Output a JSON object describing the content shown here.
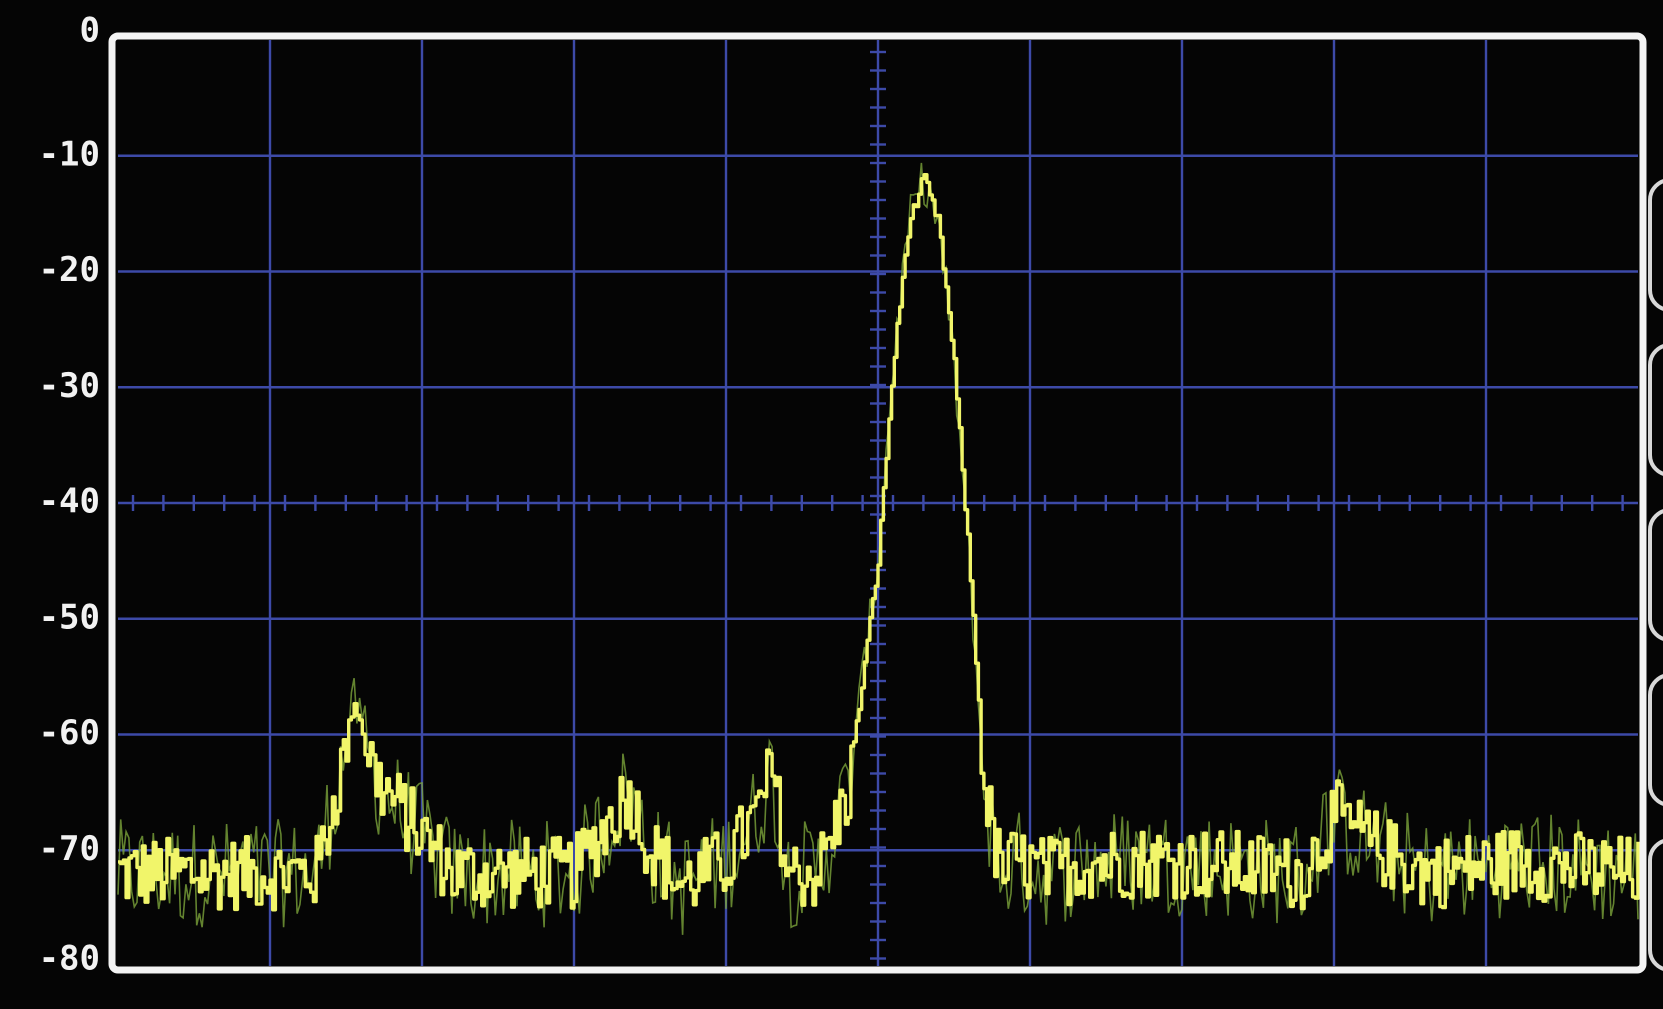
{
  "colors": {
    "background": "#050505",
    "grid": "#3d4aa8",
    "trace": "#f1f56a",
    "frame": "#f4f4f4",
    "tick_text": "#f2f2f2"
  },
  "chart_data": {
    "type": "line",
    "title": "",
    "xlabel": "",
    "ylabel": "",
    "ylim": [
      -80,
      0
    ],
    "yticks": [
      "0",
      "-10",
      "-20",
      "-30",
      "-40",
      "-50",
      "-60",
      "-70",
      "-80"
    ],
    "xlim": [
      0,
      100
    ],
    "grid": true,
    "vertical_divisions": 10,
    "noise_floor": -72,
    "series": [
      {
        "type": "trace",
        "x": [
          0,
          8,
          13,
          14.5,
          15.5,
          17,
          22,
          30,
          32,
          33.5,
          35,
          37,
          40,
          42,
          43,
          44,
          46,
          48,
          50,
          51,
          52,
          53,
          54,
          55,
          56,
          57,
          58,
          59,
          61,
          64,
          70,
          78,
          80,
          83,
          86,
          92,
          100
        ],
        "y": [
          -72,
          -72,
          -72,
          -64,
          -57,
          -64,
          -72,
          -72,
          -68,
          -65,
          -70,
          -73,
          -71,
          -67,
          -63,
          -72,
          -72,
          -65,
          -45,
          -28,
          -16,
          -12,
          -16,
          -28,
          -45,
          -65,
          -72,
          -71,
          -72,
          -71,
          -71,
          -72,
          -67,
          -70,
          -72,
          -71,
          -72
        ]
      }
    ]
  }
}
